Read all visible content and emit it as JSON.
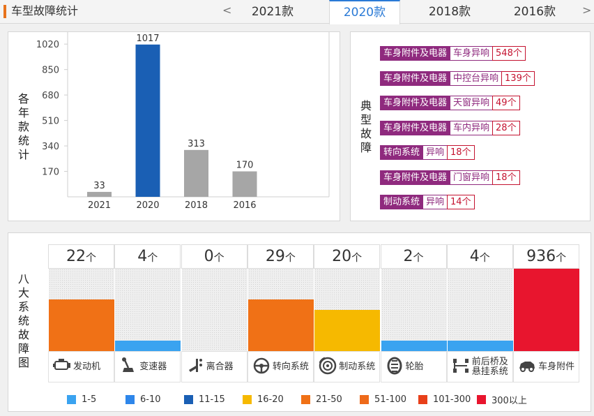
{
  "header": {
    "title": "车型故障统计",
    "prev_arrow": "<",
    "next_arrow": ">",
    "tabs": [
      {
        "label": "2021款",
        "active": false
      },
      {
        "label": "2020款",
        "active": true
      },
      {
        "label": "2018款",
        "active": false
      },
      {
        "label": "2016款",
        "active": false
      }
    ]
  },
  "chart_data": [
    {
      "type": "bar",
      "ylabel": "各年款统计",
      "categories": [
        "2021",
        "2020",
        "2018",
        "2016"
      ],
      "values": [
        33,
        1017,
        313,
        170
      ],
      "highlight_index": 1,
      "ylim": [
        0,
        1100
      ],
      "yticks": [
        170,
        340,
        510,
        680,
        850,
        1020
      ],
      "colors": {
        "default": "#a6a6a6",
        "highlight": "#1a5fb4"
      },
      "grid": false,
      "legend": "none"
    },
    {
      "type": "bar",
      "ylabel": "八大系统故障图",
      "categories": [
        "发动机",
        "变速器",
        "离合器",
        "转向系统",
        "制动系统",
        "轮胎",
        "前后桥及悬挂系统",
        "车身附件"
      ],
      "values": [
        22,
        4,
        0,
        29,
        20,
        2,
        4,
        936
      ],
      "unit": "个",
      "level_fraction": [
        0.625,
        0.125,
        0,
        0.625,
        0.5,
        0.125,
        0.125,
        1.0
      ],
      "bar_colors": [
        "#f07116",
        "#3aa3f0",
        "#ffffff",
        "#f07116",
        "#f6b900",
        "#3aa3f0",
        "#3aa3f0",
        "#e8152e"
      ],
      "icons": [
        "engine-icon",
        "gear-shift-icon",
        "clutch-icon",
        "steering-wheel-icon",
        "brake-disc-icon",
        "tire-icon",
        "suspension-icon",
        "car-body-icon"
      ],
      "legend": "bottom",
      "legend_entries": [
        {
          "label": "1-5",
          "color": "#3aa3f0"
        },
        {
          "label": "6-10",
          "color": "#2e86ea"
        },
        {
          "label": "11-15",
          "color": "#1a5fb4"
        },
        {
          "label": "16-20",
          "color": "#f6b900"
        },
        {
          "label": "21-50",
          "color": "#f07116"
        },
        {
          "label": "51-100",
          "color": "#ee6a1a"
        },
        {
          "label": "101-300",
          "color": "#e8401a"
        },
        {
          "label": "300以上",
          "color": "#e8152e"
        }
      ]
    }
  ],
  "typical_faults": {
    "label": "典型故障",
    "items": [
      {
        "category": "车身附件及电器",
        "sub": "车身异响",
        "count": "548个"
      },
      {
        "category": "车身附件及电器",
        "sub": "中控台异响",
        "count": "139个"
      },
      {
        "category": "车身附件及电器",
        "sub": "天窗异响",
        "count": "49个"
      },
      {
        "category": "车身附件及电器",
        "sub": "车内异响",
        "count": "28个"
      },
      {
        "category": "转向系统",
        "sub": "异响",
        "count": "18个"
      },
      {
        "category": "车身附件及电器",
        "sub": "门窗异响",
        "count": "18个"
      },
      {
        "category": "制动系统",
        "sub": "异响",
        "count": "14个"
      }
    ]
  },
  "colors": {
    "accent": "#2a7ad6",
    "title_bar": "#e8731c",
    "fault_tag": "#8f2a7e",
    "fault_count": "#c4122f"
  }
}
